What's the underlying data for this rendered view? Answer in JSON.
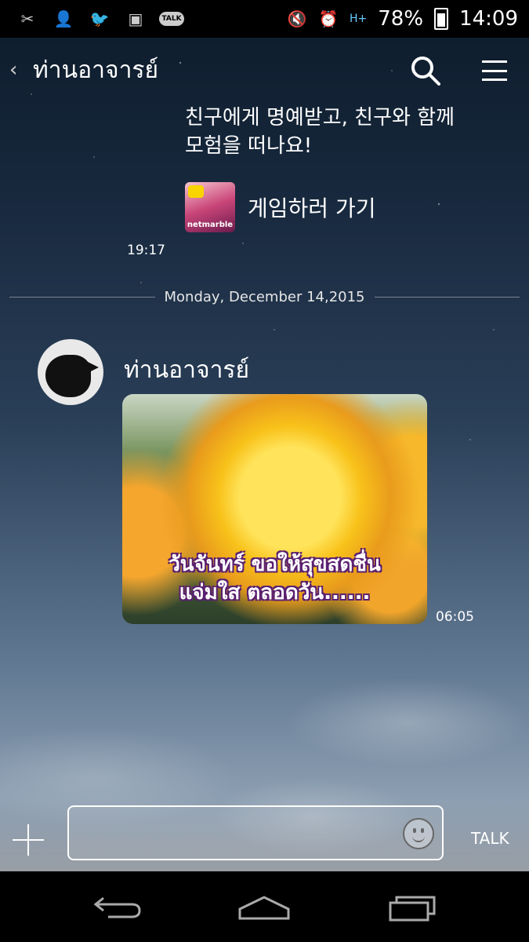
{
  "status_bar": {
    "left_icons": [
      "tools-icon",
      "add-contact-icon",
      "twitter-icon",
      "image-icon",
      "talk-icon"
    ],
    "talk_badge": "TALK",
    "battery_percent": "78%",
    "time": "14:09",
    "network": "H+"
  },
  "header": {
    "title": "ท่านอาจารย์"
  },
  "messages": {
    "game_text_line1": "친구에게 명예받고, 친구와 함께",
    "game_text_line2": "모험을 떠나요!",
    "game_icon_label": "netmarble",
    "game_link": "게임하러 가기",
    "game_time": "19:17",
    "date_divider": "Monday, December 14,2015",
    "sender_name": "ท่านอาจารย์",
    "photo_caption_line1": "วันจันทร์ ขอให้สุขสดชื่น",
    "photo_caption_line2": "แจ่มใส ตลอดวัน......",
    "photo_time": "06:05"
  },
  "input_bar": {
    "placeholder": "",
    "talk_label": "TALK"
  }
}
